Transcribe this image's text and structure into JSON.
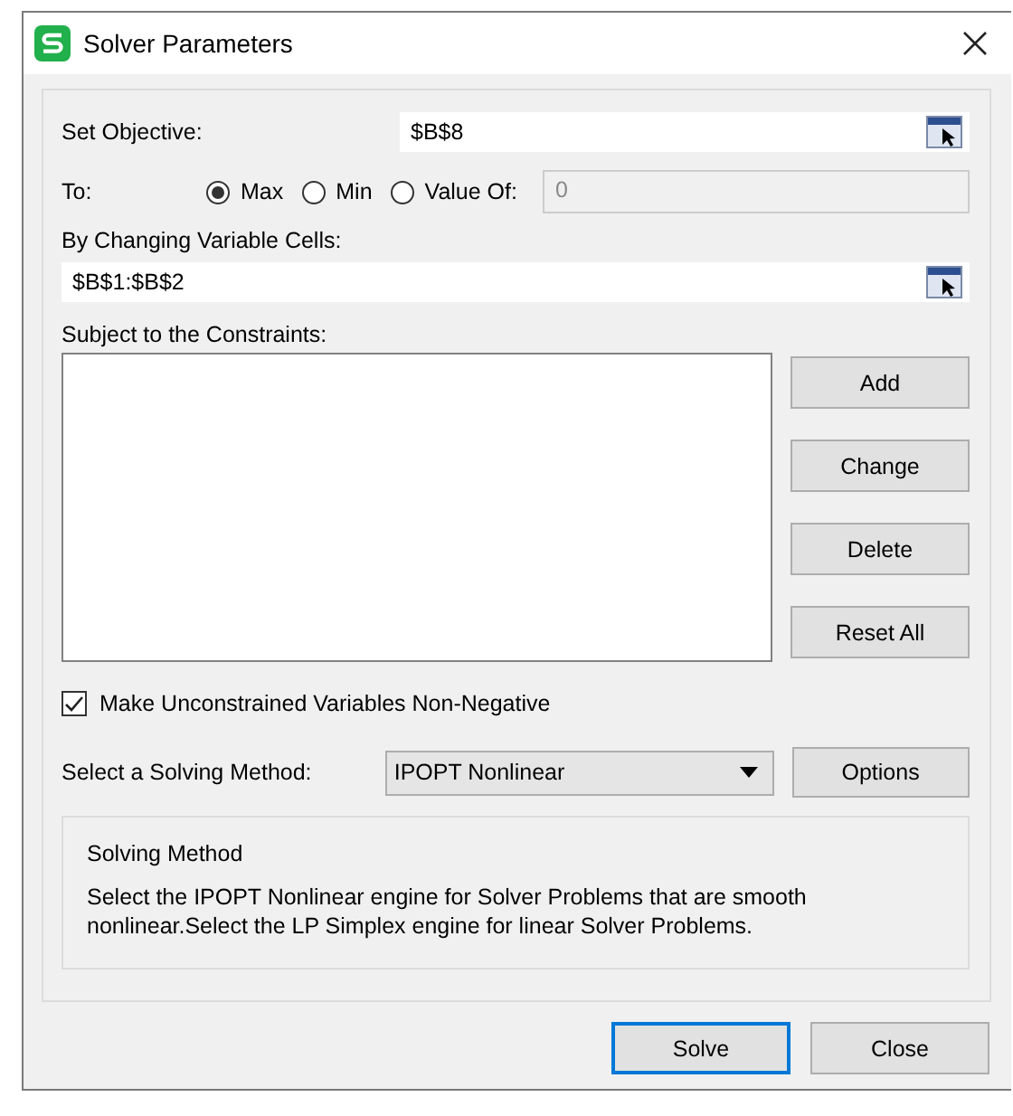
{
  "window": {
    "title": "Solver Parameters"
  },
  "objective": {
    "label": "Set Objective:",
    "value": "$B$8"
  },
  "target": {
    "label": "To:",
    "options": [
      {
        "label": "Max",
        "selected": true
      },
      {
        "label": "Min",
        "selected": false
      },
      {
        "label": "Value Of:",
        "selected": false
      }
    ],
    "value_of": {
      "value": "0",
      "disabled": true
    }
  },
  "variables": {
    "label": "By Changing Variable Cells:",
    "value": "$B$1:$B$2"
  },
  "constraints": {
    "label": "Subject to the Constraints:",
    "buttons": [
      "Add",
      "Change",
      "Delete",
      "Reset All"
    ]
  },
  "non_negative": {
    "label": "Make Unconstrained Variables Non-Negative",
    "checked": true
  },
  "method": {
    "label": "Select a Solving Method:",
    "value": "IPOPT Nonlinear",
    "button": "Options"
  },
  "description": {
    "title": "Solving Method",
    "text": "Select the IPOPT Nonlinear engine for Solver Problems that are smooth nonlinear.Select the LP Simplex engine for linear Solver Problems."
  },
  "buttons": [
    {
      "label": "Solve",
      "default": true
    },
    {
      "label": "Close",
      "default": false
    }
  ]
}
